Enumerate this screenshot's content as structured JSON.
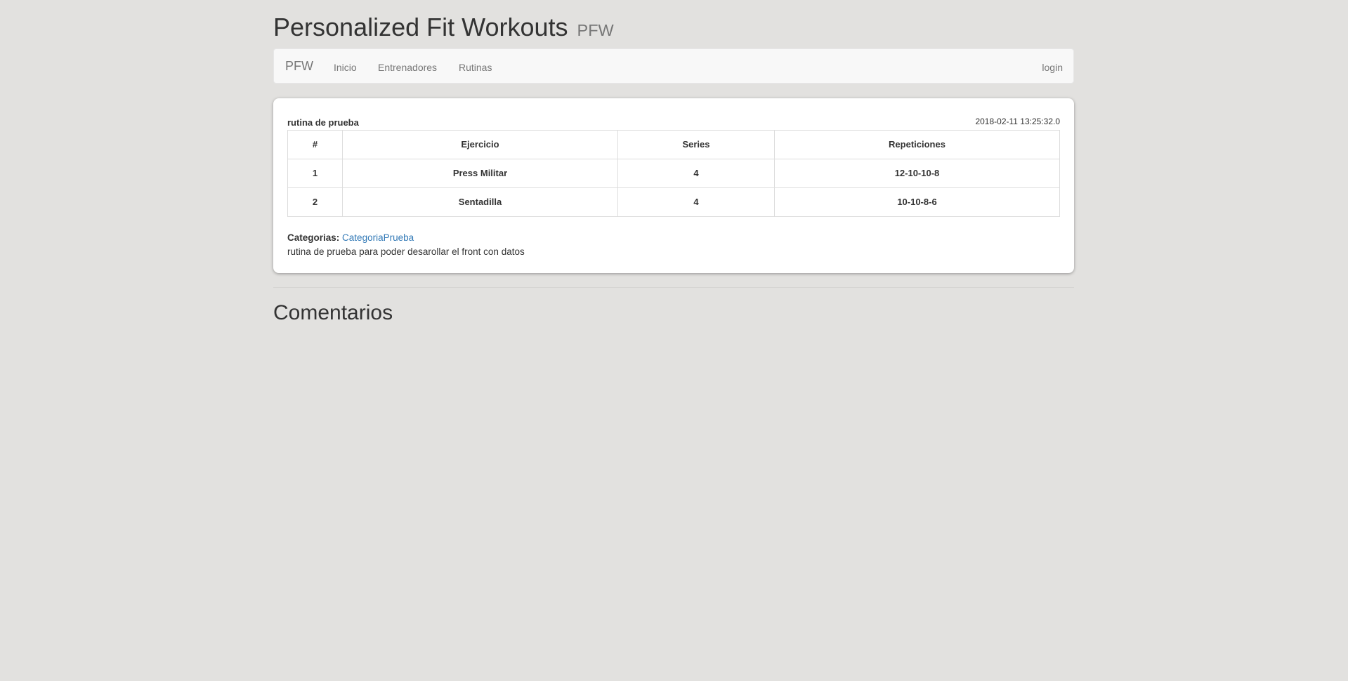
{
  "header": {
    "title": "Personalized Fit Workouts",
    "subtitle": "PFW"
  },
  "navbar": {
    "brand": "PFW",
    "links": [
      {
        "label": "Inicio"
      },
      {
        "label": "Entrenadores"
      },
      {
        "label": "Rutinas"
      }
    ],
    "login": "login"
  },
  "routine": {
    "name": "rutina de prueba",
    "date": "2018-02-11 13:25:32.0",
    "table": {
      "headers": [
        "#",
        "Ejercicio",
        "Series",
        "Repeticiones"
      ],
      "rows": [
        [
          "1",
          "Press Militar",
          "4",
          "12-10-10-8"
        ],
        [
          "2",
          "Sentadilla",
          "4",
          "10-10-8-6"
        ]
      ]
    },
    "categories_label": "Categorias:",
    "category": "CategoriaPrueba",
    "description": "rutina de prueba para poder desarollar el front con datos"
  },
  "comments": {
    "title": "Comentarios"
  },
  "colors": {
    "background": "#e2e1df",
    "link": "#337ab7",
    "navbar": "#f8f8f8"
  }
}
